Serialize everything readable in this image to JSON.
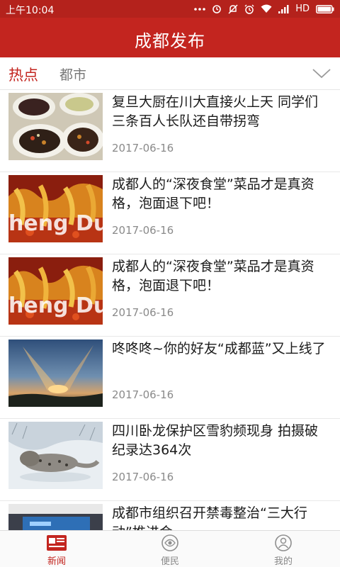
{
  "status_bar": {
    "time": "上午10:04",
    "network": "HD"
  },
  "header": {
    "title": "成都发布"
  },
  "tabs": [
    {
      "label": "热点",
      "active": true
    },
    {
      "label": "都市",
      "active": false
    }
  ],
  "news": [
    {
      "title": "复旦大厨在川大直接火上天 同学们三条百人长队还自带拐弯",
      "date": "2017-06-16",
      "thumb": "food-dishes"
    },
    {
      "title": "成都人的“深夜食堂”菜品才是真资格，泡面退下吧！",
      "date": "2017-06-16",
      "thumb": "skewers"
    },
    {
      "title": "成都人的“深夜食堂”菜品才是真资格，泡面退下吧！",
      "date": "2017-06-16",
      "thumb": "skewers"
    },
    {
      "title": "咚咚咚~你的好友“成都蓝”又上线了",
      "date": "2017-06-16",
      "thumb": "sunset-sky"
    },
    {
      "title": "四川卧龙保护区雪豹频现身 拍摄破纪录达364次",
      "date": "2017-06-16",
      "thumb": "snow-leopard"
    },
    {
      "title": "成都市组织召开禁毒整治“三大行动”推进会",
      "date": "",
      "thumb": "meeting-hall"
    }
  ],
  "bottom_nav": [
    {
      "label": "新闻",
      "active": true,
      "icon": "newspaper-icon"
    },
    {
      "label": "便民",
      "active": false,
      "icon": "service-icon"
    },
    {
      "label": "我的",
      "active": false,
      "icon": "profile-icon"
    }
  ],
  "colors": {
    "brand_red": "#c3251f",
    "status_red": "#b4221c"
  }
}
